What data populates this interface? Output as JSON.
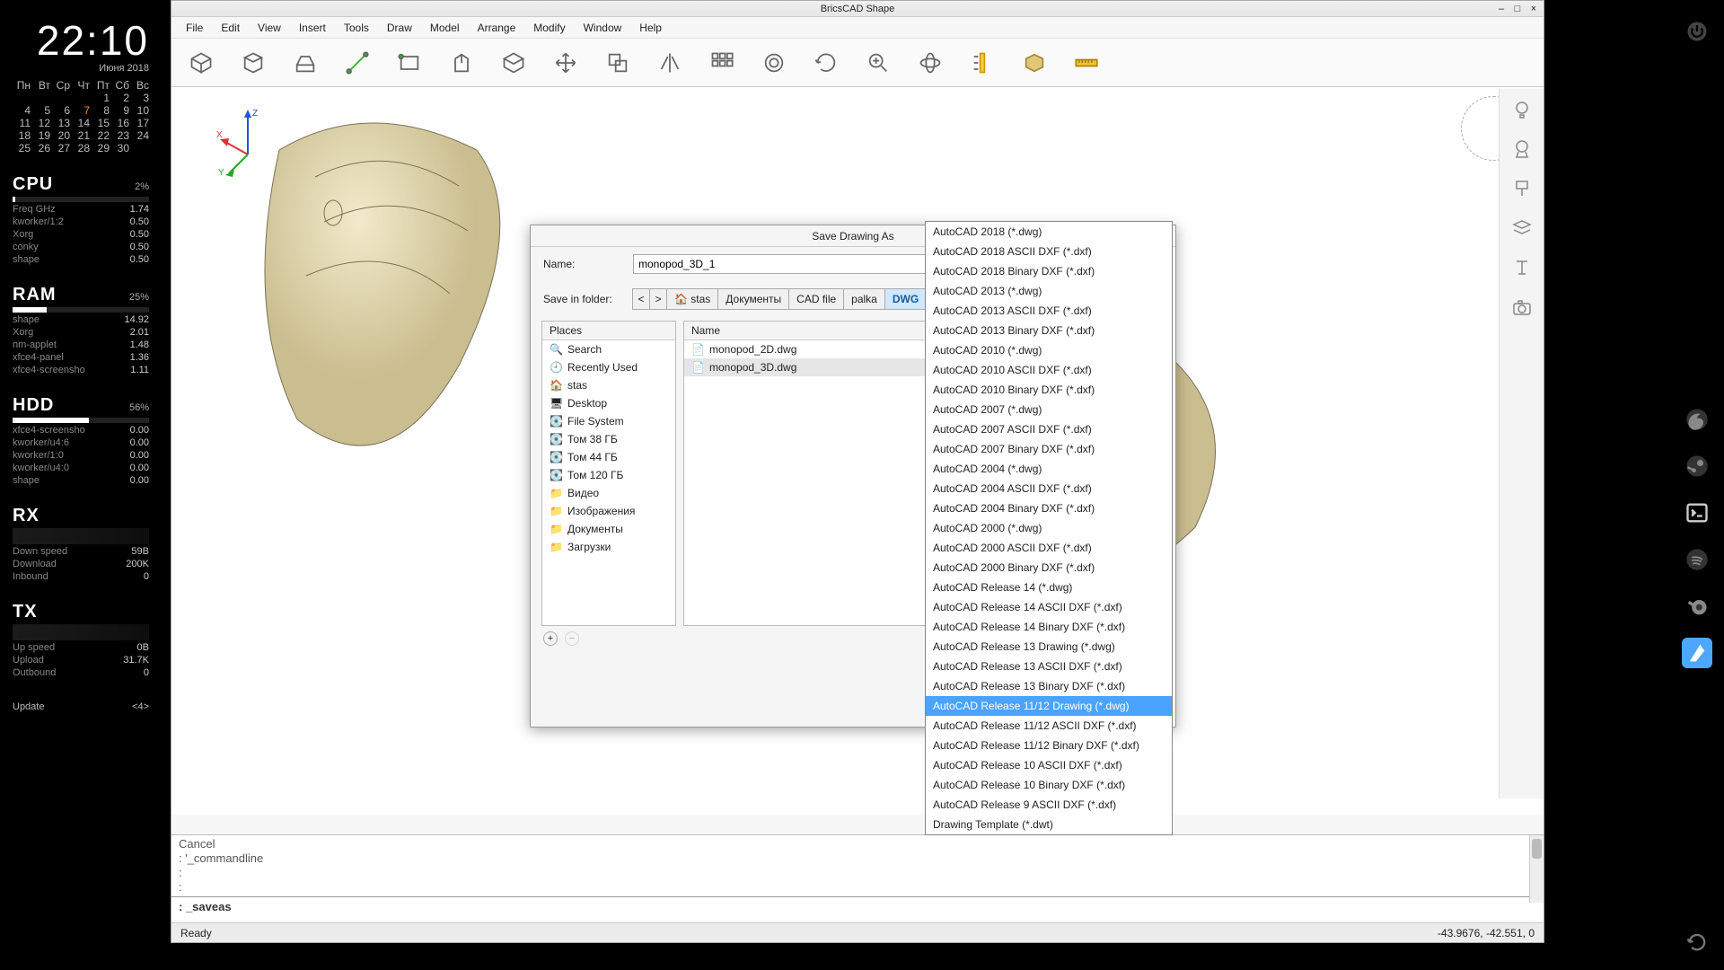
{
  "conky": {
    "clock": "22:10",
    "date": "Июня 2018",
    "dow": [
      "Пн",
      "Вт",
      "Ср",
      "Чт",
      "Пт",
      "Сб",
      "Вс"
    ],
    "cal": [
      [
        "",
        "",
        "",
        "",
        "1",
        "2",
        "3"
      ],
      [
        "4",
        "5",
        "6",
        "7",
        "8",
        "9",
        "10"
      ],
      [
        "11",
        "12",
        "13",
        "14",
        "15",
        "16",
        "17"
      ],
      [
        "18",
        "19",
        "20",
        "21",
        "22",
        "23",
        "24"
      ],
      [
        "25",
        "26",
        "27",
        "28",
        "29",
        "30",
        ""
      ]
    ],
    "today": "7",
    "cpu": {
      "label": "CPU",
      "pct": "2%",
      "rows": [
        [
          "Freq GHz",
          "1.74"
        ],
        [
          "kworker/1:2",
          "0.50"
        ],
        [
          "Xorg",
          "0.50"
        ],
        [
          "conky",
          "0.50"
        ],
        [
          "shape",
          "0.50"
        ]
      ]
    },
    "ram": {
      "label": "RAM",
      "pct": "25%",
      "rows": [
        [
          "shape",
          "14.92"
        ],
        [
          "Xorg",
          "2.01"
        ],
        [
          "nm-applet",
          "1.48"
        ],
        [
          "xfce4-panel",
          "1.36"
        ],
        [
          "xfce4-screensho",
          "1.11"
        ]
      ]
    },
    "hdd": {
      "label": "HDD",
      "pct": "56%",
      "rows": [
        [
          "xfce4-screensho",
          "0.00"
        ],
        [
          "kworker/u4:6",
          "0.00"
        ],
        [
          "kworker/1:0",
          "0.00"
        ],
        [
          "kworker/u4:0",
          "0.00"
        ],
        [
          "shape",
          "0.00"
        ]
      ]
    },
    "rx": {
      "label": "RX",
      "rows": [
        [
          "Down speed",
          "59B"
        ],
        [
          "Download",
          "200K"
        ],
        [
          "Inbound",
          "0"
        ]
      ]
    },
    "tx": {
      "label": "TX",
      "rows": [
        [
          "Up speed",
          "0B"
        ],
        [
          "Upload",
          "31.7K"
        ],
        [
          "Outbound",
          "0"
        ]
      ]
    },
    "update": {
      "label": "Update",
      "value": "<4>"
    }
  },
  "app": {
    "title": "BricsCAD Shape",
    "menu": [
      "File",
      "Edit",
      "View",
      "Insert",
      "Tools",
      "Draw",
      "Model",
      "Arrange",
      "Modify",
      "Window",
      "Help"
    ],
    "cmd_history": [
      "Cancel",
      ": '_commandline",
      ":",
      ":"
    ],
    "cmd_prompt_prefix": ": ",
    "cmd_prompt": "_saveas",
    "status_left": "Ready",
    "status_right": "-43.9676, -42.551, 0"
  },
  "dialog": {
    "title": "Save Drawing As",
    "name_label": "Name:",
    "name_value": "monopod_3D_1",
    "folder_label": "Save in folder:",
    "crumbs": [
      "stas",
      "Документы",
      "CAD file",
      "palka",
      "DWG"
    ],
    "places_header": "Places",
    "places": [
      "Search",
      "Recently Used",
      "stas",
      "Desktop",
      "File System",
      "Том 38 ГБ",
      "Том 44 ГБ",
      "Том 120 ГБ",
      "Видео",
      "Изображения",
      "Документы",
      "Загрузки"
    ],
    "files_header": "Name",
    "files": [
      "monopod_2D.dwg",
      "monopod_3D.dwg"
    ],
    "selected_file": "monopod_3D.dwg"
  },
  "formats": {
    "selected": "AutoCAD Release 11/12 Drawing (*.dwg)",
    "items": [
      "AutoCAD 2018 (*.dwg)",
      "AutoCAD 2018 ASCII DXF (*.dxf)",
      "AutoCAD 2018 Binary DXF (*.dxf)",
      "AutoCAD 2013 (*.dwg)",
      "AutoCAD 2013 ASCII DXF (*.dxf)",
      "AutoCAD 2013 Binary DXF (*.dxf)",
      "AutoCAD 2010 (*.dwg)",
      "AutoCAD 2010 ASCII DXF (*.dxf)",
      "AutoCAD 2010 Binary DXF (*.dxf)",
      "AutoCAD 2007 (*.dwg)",
      "AutoCAD 2007 ASCII DXF (*.dxf)",
      "AutoCAD 2007 Binary DXF (*.dxf)",
      "AutoCAD 2004 (*.dwg)",
      "AutoCAD 2004 ASCII DXF (*.dxf)",
      "AutoCAD 2004 Binary DXF (*.dxf)",
      "AutoCAD 2000 (*.dwg)",
      "AutoCAD 2000 ASCII DXF (*.dxf)",
      "AutoCAD 2000 Binary DXF (*.dxf)",
      "AutoCAD Release 14 (*.dwg)",
      "AutoCAD Release 14 ASCII DXF (*.dxf)",
      "AutoCAD Release 14 Binary DXF (*.dxf)",
      "AutoCAD Release 13 Drawing (*.dwg)",
      "AutoCAD Release 13 ASCII DXF (*.dxf)",
      "AutoCAD Release 13 Binary DXF (*.dxf)",
      "AutoCAD Release 11/12 Drawing (*.dwg)",
      "AutoCAD Release 11/12 ASCII DXF (*.dxf)",
      "AutoCAD Release 11/12 Binary DXF (*.dxf)",
      "AutoCAD Release 10 ASCII DXF (*.dxf)",
      "AutoCAD Release 10 Binary DXF (*.dxf)",
      "AutoCAD Release 9 ASCII DXF (*.dxf)",
      "Drawing Template (*.dwt)"
    ]
  }
}
